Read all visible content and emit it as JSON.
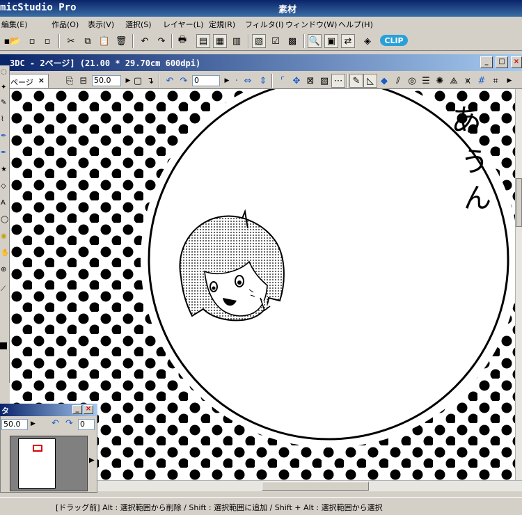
{
  "app": {
    "title": "micStudio Pro",
    "side_panel_title": "素材"
  },
  "menu": [
    "編集(E)",
    "作品(O)",
    "表示(V)",
    "選択(S)",
    "レイヤー(L)",
    "定規(R)",
    "フィルタ(I)",
    "ウィンドウ(W)",
    "ヘルプ(H)"
  ],
  "toolbar": {
    "clip_label": "CLIP"
  },
  "document": {
    "title": "3DC - 2ページ] (21.00 * 29.70cm 600dpi)",
    "tab_label": "ページ",
    "tab_close": "×",
    "zoom_value": "50.0",
    "rotation_value": "0"
  },
  "canvas": {
    "handwriting_lines": [
      "あ",
      "う",
      "ん"
    ]
  },
  "navigator": {
    "title": "タ",
    "zoom_value": "50.0",
    "rotation_value": "0"
  },
  "status_bar": {
    "text": "[ドラッグ前] Alt : 選択範囲から削除 / Shift : 選択範囲に追加 / Shift + Alt : 選択範囲から選択"
  },
  "colors": {
    "title_blue": "#0a246a",
    "chrome": "#d4d0c8",
    "clip_badge": "#2aa0d8"
  }
}
